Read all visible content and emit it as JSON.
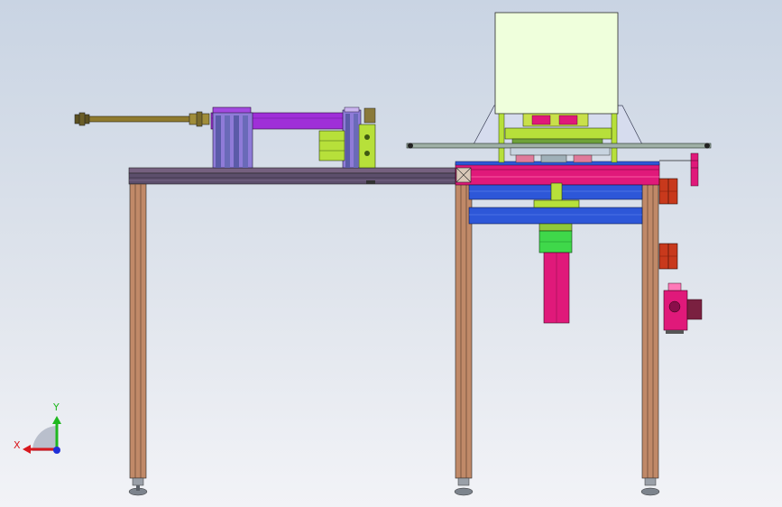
{
  "view_triad": {
    "x_label": "X",
    "y_label": "Y",
    "x_color": "#d8181e",
    "y_color": "#1fb81f",
    "z_color": "#2030d8"
  },
  "colors": {
    "background_top": "#c9d4e3",
    "background_bottom": "#f2f3f7",
    "frame_leg": "#c08968",
    "table_top": "#6f5a78",
    "slide_rail": "#9f2fd8",
    "cylinder_rod": "#8f7a2e",
    "guide_block": "#b7e03a",
    "pink_plate": "#e0197a",
    "blue_plate": "#2d57d8",
    "hopper": "#efffdc",
    "red_valve": "#c8391c"
  }
}
